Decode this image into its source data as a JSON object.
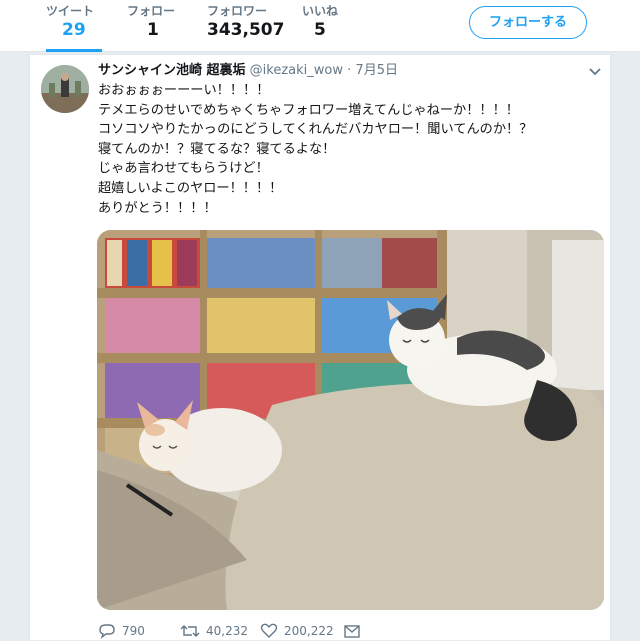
{
  "stats": [
    {
      "label": "ツイート",
      "value": "29"
    },
    {
      "label": "フォロー",
      "value": "1"
    },
    {
      "label": "フォロワー",
      "value": "343,507"
    },
    {
      "label": "いいね",
      "value": "5"
    }
  ],
  "follow_button": "フォローする",
  "tweet": {
    "display_name": "サンシャイン池崎 超裏垢",
    "handle": "@ikezaki_wow",
    "separator": "·",
    "date": "7月5日",
    "text": "おおぉぉぉーーーい！！！！\nテメエらのせいでめちゃくちゃフォロワー増えてんじゃねーか！！！！\nコソコソやりたかっのにどうしてくれんだバカヤロー！聞いてんのか！？\n寝てんのか！？寝てるな？寝てるよな！\nじゃあ言わせてもらうけど！\n超嬉しいよこのヤロー！！！！\nありがとう！！！！",
    "replies": "790",
    "retweets": "40,232",
    "likes": "200,222"
  },
  "colors": {
    "accent": "#1da1f2",
    "text_primary": "#14171a",
    "text_secondary": "#657786"
  },
  "icons": [
    "caret-down-icon",
    "reply-icon",
    "retweet-icon",
    "like-icon",
    "dm-icon"
  ]
}
